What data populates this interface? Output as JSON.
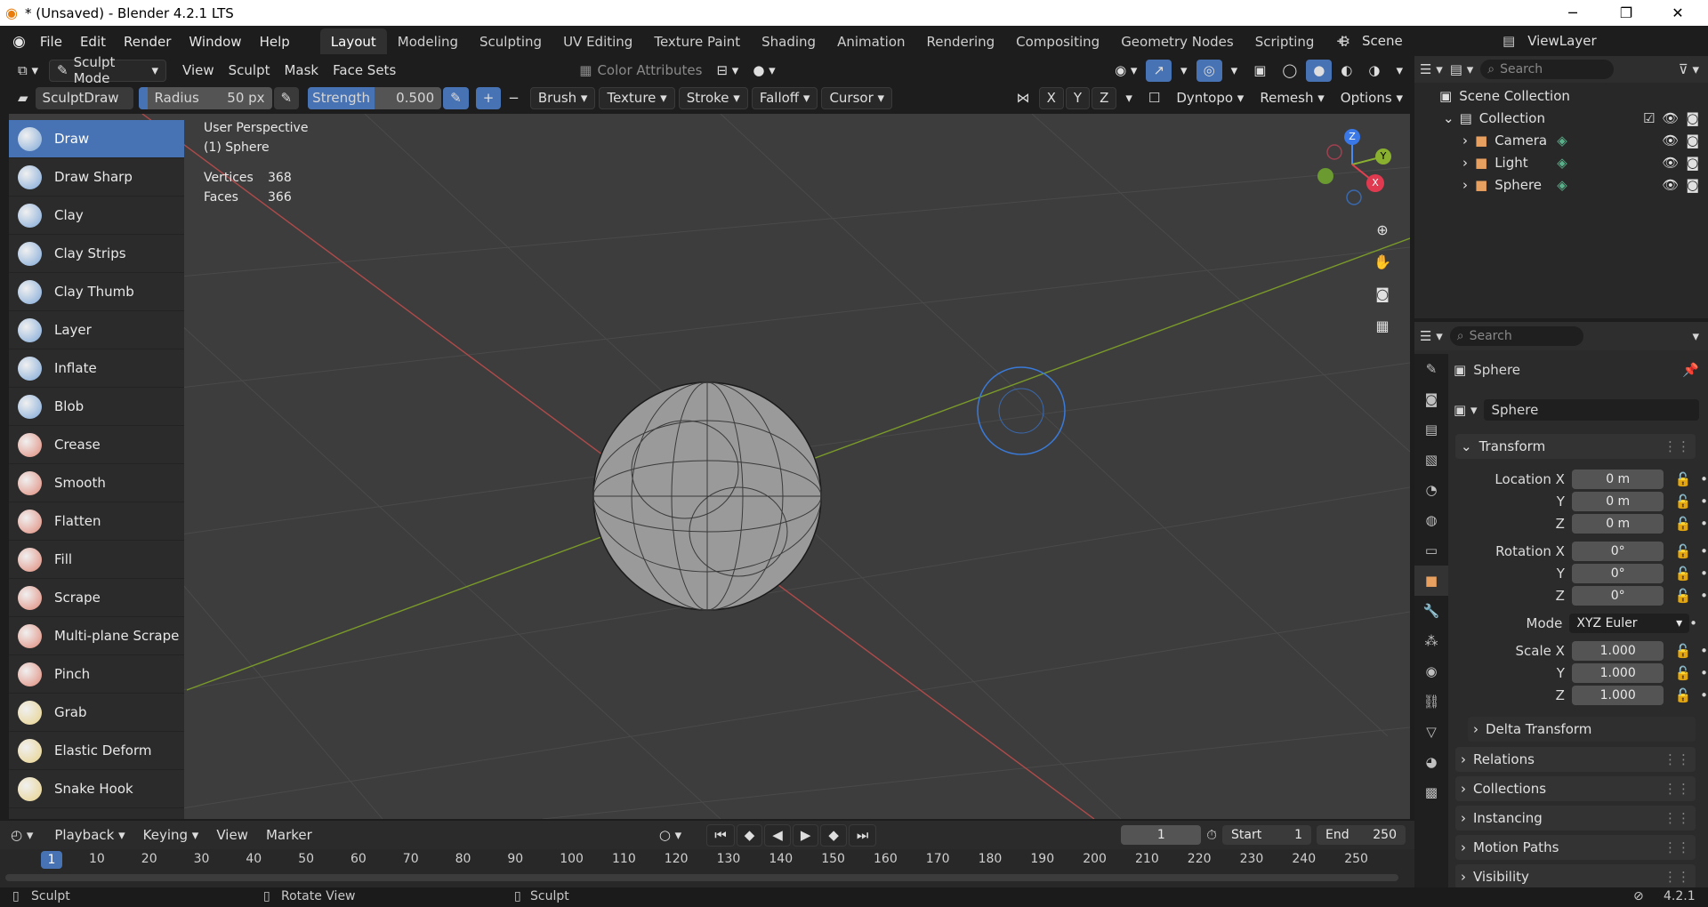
{
  "window": {
    "title": "* (Unsaved) - Blender 4.2.1 LTS",
    "minimize": "─",
    "maximize": "❐",
    "close": "✕"
  },
  "menubar": {
    "items": [
      "File",
      "Edit",
      "Render",
      "Window",
      "Help"
    ],
    "workspaces": [
      "Layout",
      "Modeling",
      "Sculpting",
      "UV Editing",
      "Texture Paint",
      "Shading",
      "Animation",
      "Rendering",
      "Compositing",
      "Geometry Nodes",
      "Scripting"
    ],
    "active_workspace": "Layout",
    "add_workspace": "+",
    "scene": "Scene",
    "view_layer": "ViewLayer"
  },
  "viewport_header": {
    "mode": "Sculpt Mode",
    "menus": [
      "View",
      "Sculpt",
      "Mask",
      "Face Sets"
    ],
    "color_attributes": "Color Attributes"
  },
  "tool_settings": {
    "brush_name": "SculptDraw",
    "radius_label": "Radius",
    "radius_value": "50 px",
    "strength_label": "Strength",
    "strength_value": "0.500",
    "plus": "+",
    "minus": "−",
    "dropdowns": [
      "Brush",
      "Texture",
      "Stroke",
      "Falloff",
      "Cursor"
    ],
    "axes": [
      "X",
      "Y",
      "Z"
    ],
    "dyntopo": "Dyntopo",
    "remesh": "Remesh",
    "options": "Options"
  },
  "brushes": [
    {
      "label": "Draw",
      "color": "#7fa8d8",
      "active": true
    },
    {
      "label": "Draw Sharp",
      "color": "#7fa8d8"
    },
    {
      "label": "Clay",
      "color": "#7fa8d8"
    },
    {
      "label": "Clay Strips",
      "color": "#7fa8d8"
    },
    {
      "label": "Clay Thumb",
      "color": "#7fa8d8"
    },
    {
      "label": "Layer",
      "color": "#7fa8d8"
    },
    {
      "label": "Inflate",
      "color": "#7fa8d8"
    },
    {
      "label": "Blob",
      "color": "#7fa8d8"
    },
    {
      "label": "Crease",
      "color": "#e08a7a"
    },
    {
      "label": "Smooth",
      "color": "#e08a7a"
    },
    {
      "label": "Flatten",
      "color": "#e08a7a"
    },
    {
      "label": "Fill",
      "color": "#e08a7a"
    },
    {
      "label": "Scrape",
      "color": "#e08a7a"
    },
    {
      "label": "Multi-plane Scrape",
      "color": "#e08a7a"
    },
    {
      "label": "Pinch",
      "color": "#e08a7a"
    },
    {
      "label": "Grab",
      "color": "#e8d28a"
    },
    {
      "label": "Elastic Deform",
      "color": "#e8d28a"
    },
    {
      "label": "Snake Hook",
      "color": "#e8d28a"
    }
  ],
  "viewport_info": {
    "perspective": "User Perspective",
    "object": "(1) Sphere",
    "vertices_label": "Vertices",
    "vertices_value": "368",
    "faces_label": "Faces",
    "faces_value": "366"
  },
  "gizmo": {
    "x": "X",
    "y": "Y",
    "z": "Z"
  },
  "outliner": {
    "search_placeholder": "Search",
    "root": "Scene Collection",
    "collection": "Collection",
    "items": [
      {
        "label": "Camera",
        "color": "#e8a060"
      },
      {
        "label": "Light",
        "color": "#e8a060"
      },
      {
        "label": "Sphere",
        "color": "#e8a060"
      }
    ]
  },
  "properties": {
    "search_placeholder": "Search",
    "object_name": "Sphere",
    "datablock": "Sphere",
    "transform_label": "Transform",
    "location_label": "Location X",
    "rotation_label": "Rotation X",
    "scale_label": "Scale X",
    "y_label": "Y",
    "z_label": "Z",
    "location": [
      "0 m",
      "0 m",
      "0 m"
    ],
    "rotation": [
      "0°",
      "0°",
      "0°"
    ],
    "mode_label": "Mode",
    "mode_value": "XYZ Euler",
    "scale": [
      "1.000",
      "1.000",
      "1.000"
    ],
    "delta_transform": "Delta Transform",
    "panels": [
      "Relations",
      "Collections",
      "Instancing",
      "Motion Paths",
      "Visibility"
    ]
  },
  "timeline": {
    "menus": [
      "Playback",
      "Keying",
      "View",
      "Marker"
    ],
    "current_frame": "1",
    "start_label": "Start",
    "start_value": "1",
    "end_label": "End",
    "end_value": "250",
    "ruler": [
      "10",
      "20",
      "30",
      "40",
      "50",
      "60",
      "70",
      "80",
      "90",
      "100",
      "110",
      "120",
      "130",
      "140",
      "150",
      "160",
      "170",
      "180",
      "190",
      "200",
      "210",
      "220",
      "230",
      "240",
      "250"
    ],
    "ruler_current": "1"
  },
  "statusbar": {
    "left": "Sculpt",
    "middle": "Rotate View",
    "right": "Sculpt",
    "version": "4.2.1"
  }
}
